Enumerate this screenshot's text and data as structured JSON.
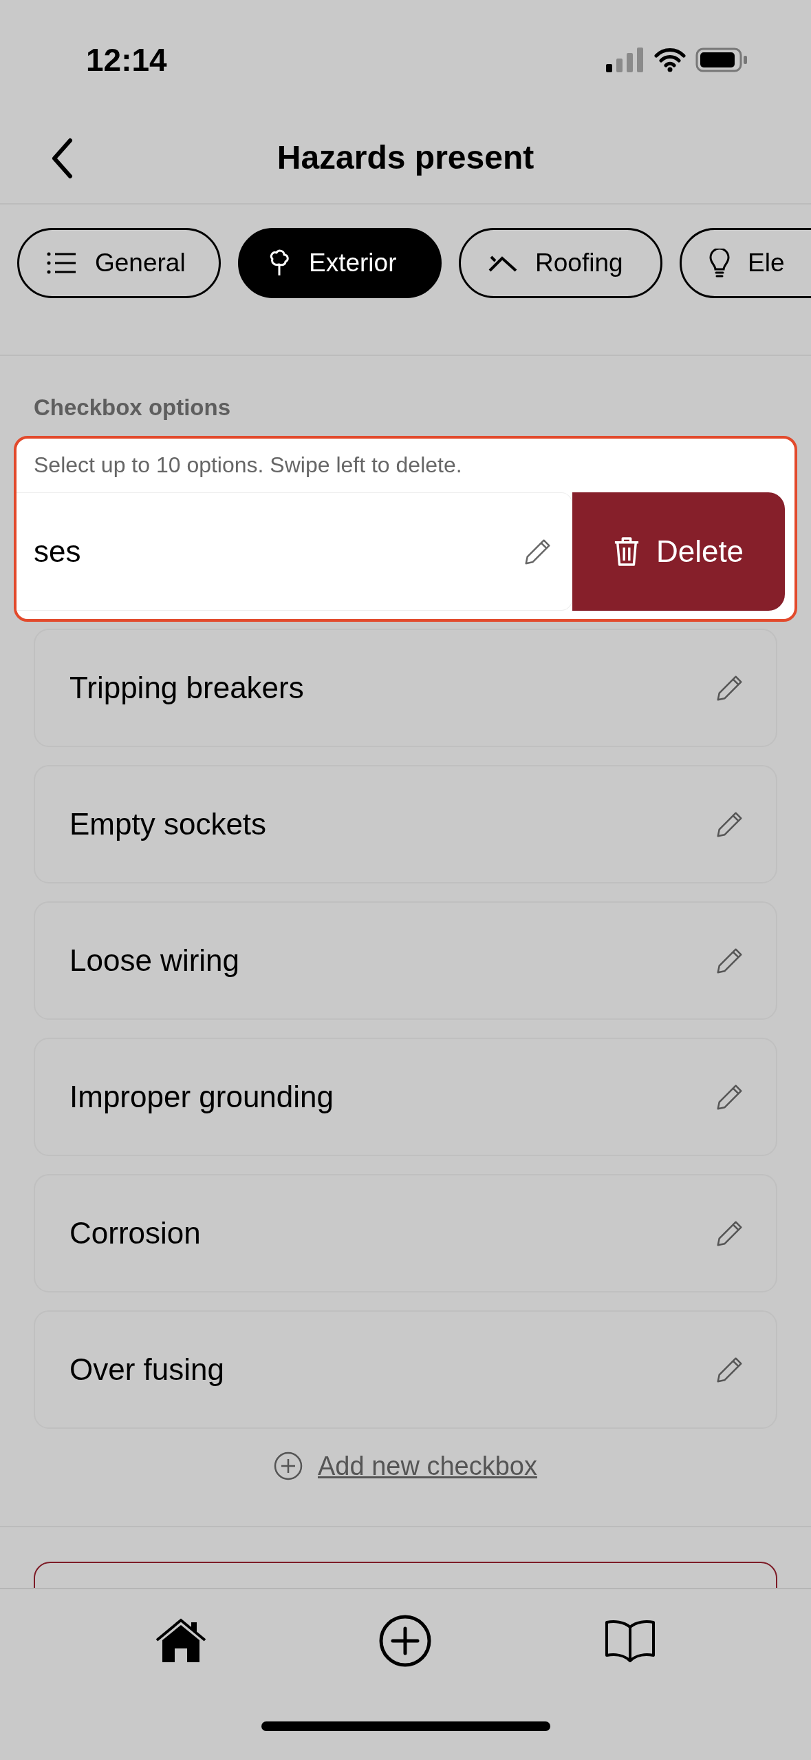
{
  "status_bar": {
    "time": "12:14"
  },
  "header": {
    "title": "Hazards present"
  },
  "tabs": [
    {
      "label": "General",
      "selected": false
    },
    {
      "label": "Exterior",
      "selected": true
    },
    {
      "label": "Roofing",
      "selected": false
    },
    {
      "label": "Ele",
      "selected": false
    }
  ],
  "section": {
    "title": "Checkbox options",
    "hint": "Select up to 10 options. Swipe left to delete.",
    "swiped_option": {
      "label": "ses",
      "action": "Delete"
    },
    "options": [
      {
        "label": "Tripping breakers"
      },
      {
        "label": "Empty sockets"
      },
      {
        "label": "Loose wiring"
      },
      {
        "label": "Improper grounding"
      },
      {
        "label": "Corrosion"
      },
      {
        "label": "Over fusing"
      }
    ],
    "add_link": "Add new checkbox"
  }
}
